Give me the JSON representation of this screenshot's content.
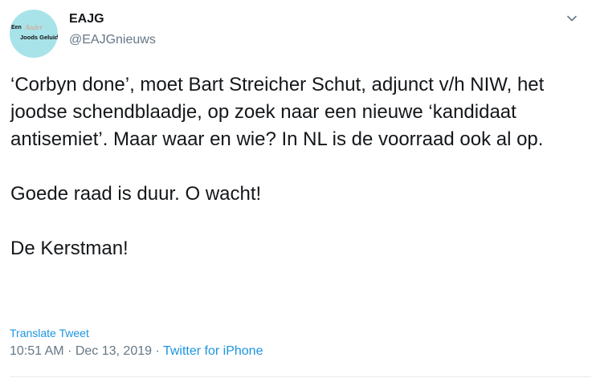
{
  "author": {
    "avatar_text_top_left": "Een",
    "avatar_text_top_script": "Ander",
    "avatar_text_bottom": "Joods Geluid",
    "name": "EAJG",
    "handle": "@EAJGnieuws"
  },
  "menu": {
    "icon": "chevron-down-icon"
  },
  "tweet": {
    "paragraphs": [
      "‘Corbyn done’, moet Bart Streicher Schut, adjunct v/h NIW, het joodse schendblaadje, op zoek naar een nieuwe ‘kandidaat antisemiet’. Maar waar en wie? In NL is de voorraad ook al op.",
      "Goede raad is duur. O wacht!",
      "De Kerstman!"
    ],
    "translate_label": "Translate Tweet",
    "time": "10:51 AM",
    "separator": "·",
    "date": "Dec 13, 2019",
    "source": "Twitter for iPhone"
  }
}
